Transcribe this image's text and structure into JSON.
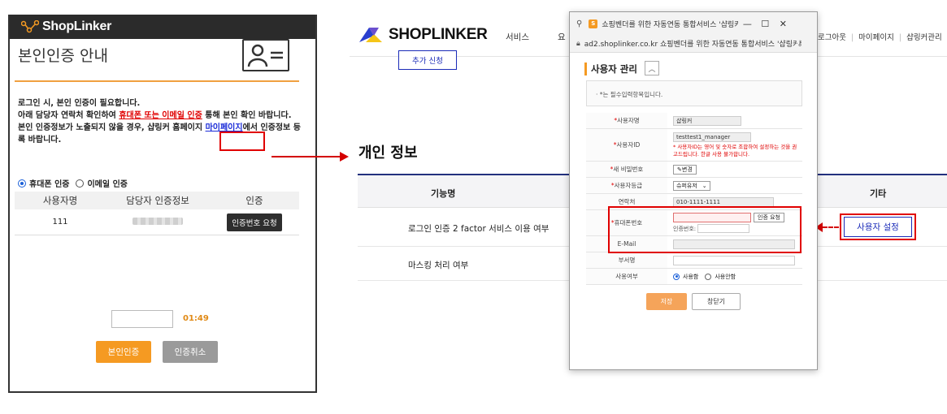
{
  "left_popup": {
    "logo_text": "ShopLinker",
    "title": "본인인증 안내",
    "notice_line1": "로그인 시, 본인 인증이 필요합니다.",
    "notice_line2_a": "아래 담당자 연락처 확인하여 ",
    "notice_line2_red": "휴대폰 또는 이메일 인증",
    "notice_line2_b": " 통해 본인 확인 바랍니다.",
    "notice_line3_a": "본인 인증정보가 노출되지 않을 경우, 샵링커 홈페이지 ",
    "notice_line3_link": "마이페이지",
    "notice_line3_b": "에서 인증정보 등록 바랍니다.",
    "radio_phone": "휴대폰 인증",
    "radio_email": "이메일 인증",
    "table_headers": [
      "사용자명",
      "담당자 인증정보",
      "인증"
    ],
    "row_user": "111",
    "request_button": "인증번호 요청",
    "timer": "01:49",
    "verify_button": "본인인증",
    "cancel_button": "인증취소"
  },
  "main_page": {
    "logo_text": "SHOPLINKER",
    "nav_service": "서비스",
    "nav_cut": "요",
    "nav_logout": "로그아웃",
    "nav_mypage": "마이페이지",
    "nav_admin": "샵링커관리",
    "add_button": "추가 신청",
    "section_title": "개인 정보",
    "table_headers": {
      "function": "기능명",
      "etc": "기타"
    },
    "row1_label": "로그인 인증 2 factor 서비스 이용 여부",
    "row2_label": "마스킹 처리 여부",
    "user_setting_button": "사용자 설정"
  },
  "popup": {
    "window_title": "쇼핑벤더를 위한 자동연동 통합서비스 '샵링커|Sho...",
    "url": "ad2.shoplinker.co.kr 쇼핑벤더를 위한 자동연동 통합서비스 '샵링커|S...",
    "section_title": "사용자 관리",
    "required_note": "· *는 필수입력항목입니다.",
    "labels": {
      "username": "사용자명",
      "userid": "사용자ID",
      "new_password": "새 비밀번호",
      "grade": "사용자등급",
      "contact": "연락처",
      "phone": "휴대폰번호",
      "email": "E-Mail",
      "department": "부서명",
      "usage": "사용여부"
    },
    "values": {
      "username": "샵링커",
      "userid": "testtest1_manager",
      "userid_warning": "* 사용자ID는 영어 및 숫자로 조합하여 설정하는 것을 권고드립니다. 한글 사용 불가합니다.",
      "change_button": "변경",
      "grade": "슈퍼유저",
      "contact": "010-1111-1111",
      "phone_request_button": "인증 요청",
      "code_label": "인증번호:",
      "usage_on": "사용함",
      "usage_off": "사용안함"
    },
    "save_button": "저장",
    "close_button": "창닫기"
  },
  "colors": {
    "accent_orange": "#f59a22",
    "highlight_red": "#e00000",
    "brand_blue": "#1a2bb8",
    "navy_line": "#23307e"
  }
}
